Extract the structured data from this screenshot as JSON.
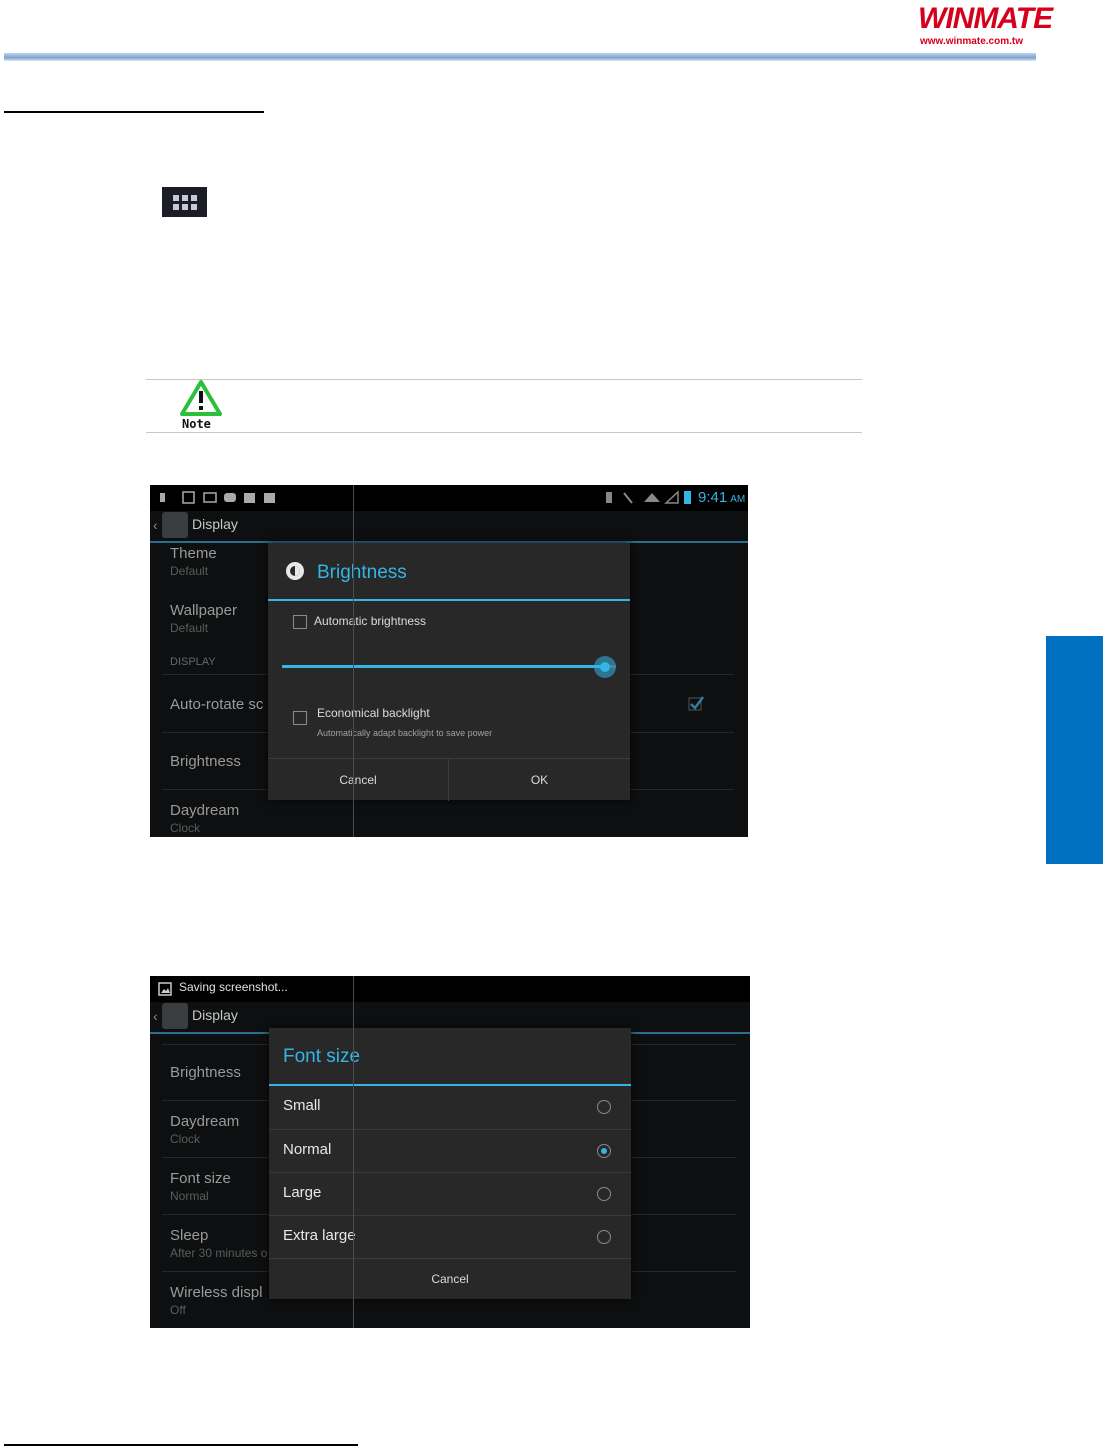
{
  "header": {
    "logo_text": "WINMATE",
    "logo_url": "www.winmate.com.tw"
  },
  "screenshot1": {
    "status_time": "9:41",
    "status_ampm": "AM",
    "actionbar_title": "Display",
    "list": [
      {
        "title": "Theme",
        "summary": "Default"
      },
      {
        "title": "Wallpaper",
        "summary": "Default"
      },
      {
        "category": "DISPLAY"
      },
      {
        "title": "Auto-rotate sc"
      },
      {
        "title": "Brightness"
      },
      {
        "title": "Daydream",
        "summary": "Clock"
      }
    ],
    "dialog": {
      "title": "Brightness",
      "auto_label": "Automatic brightness",
      "slider_value": 1.0,
      "eco_label": "Economical backlight",
      "eco_summary": "Automatically adapt backlight to save power",
      "cancel": "Cancel",
      "ok": "OK"
    }
  },
  "screenshot2": {
    "status_text": "Saving screenshot...",
    "actionbar_title": "Display",
    "list": [
      {
        "title": "Brightness"
      },
      {
        "title": "Daydream",
        "summary": "Clock"
      },
      {
        "title": "Font size",
        "summary": "Normal"
      },
      {
        "title": "Sleep",
        "summary": "After 30 minutes o"
      },
      {
        "title": "Wireless displ",
        "summary": "Off"
      }
    ],
    "dialog": {
      "title": "Font size",
      "options": [
        "Small",
        "Normal",
        "Large",
        "Extra large"
      ],
      "selected_index": 1,
      "cancel": "Cancel"
    }
  },
  "colors": {
    "accent": "#33b5e5",
    "brand": "#d6001c",
    "side_tab": "#0070c0"
  }
}
